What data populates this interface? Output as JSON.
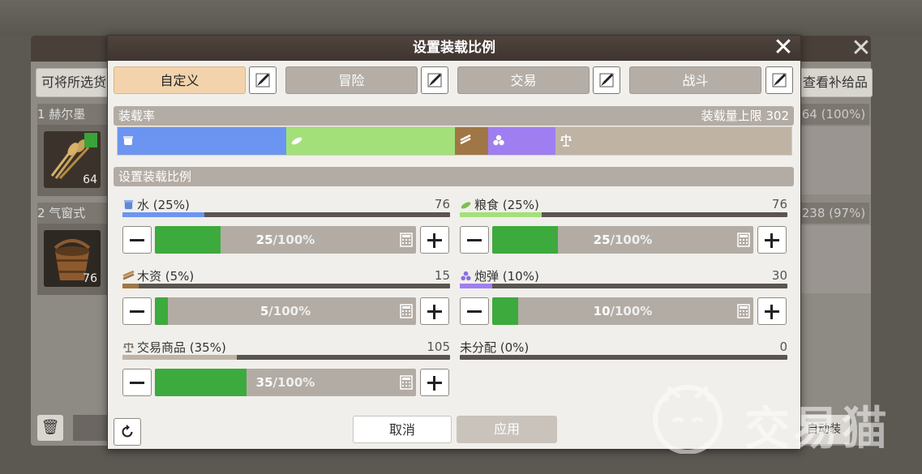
{
  "background": {
    "left_button": "可将所选货",
    "right_button": "查看补给品",
    "rows": [
      {
        "label": "1  赫尔墨",
        "right_text": "64 (100%)",
        "qty": "64"
      },
      {
        "label": "2  气窗式",
        "right_text": "238 (97%)",
        "qty": "76"
      }
    ],
    "bottom_right_button": "自动装"
  },
  "dialog": {
    "title": "设置装载比例",
    "presets": [
      {
        "label": "自定义",
        "active": true
      },
      {
        "label": "冒险",
        "active": false
      },
      {
        "label": "交易",
        "active": false
      },
      {
        "label": "战斗",
        "active": false
      }
    ],
    "load_rate": {
      "header": "装载率",
      "capacity_label": "装载量上限 302",
      "segments": [
        {
          "name": "水",
          "fraction": 0.25,
          "color": "#6b95f0",
          "icon": "water-bucket-icon"
        },
        {
          "name": "粮食",
          "fraction": 0.25,
          "color": "#a3e07a",
          "icon": "food-icon"
        },
        {
          "name": "木资",
          "fraction": 0.05,
          "color": "#a07646",
          "icon": "lumber-icon"
        },
        {
          "name": "炮弹",
          "fraction": 0.1,
          "color": "#9f7ef1",
          "icon": "cannonball-icon"
        },
        {
          "name": "交易商品",
          "fraction": 0.35,
          "color": "#bfb4a4",
          "icon": "trade-goods-icon"
        }
      ]
    },
    "ratio_header": "设置装载比例",
    "resources": [
      {
        "label": "水 (25%)",
        "value": "76",
        "fraction": 0.25,
        "bar_color": "#6b95f0",
        "slider_pct": "25",
        "slider_max": "100%",
        "icon": "water-bucket-icon"
      },
      {
        "label": "粮食 (25%)",
        "value": "76",
        "fraction": 0.25,
        "bar_color": "#a3e07a",
        "slider_pct": "25",
        "slider_max": "100%",
        "icon": "food-icon"
      },
      {
        "label": "木资 (5%)",
        "value": "15",
        "fraction": 0.05,
        "bar_color": "#a07646",
        "slider_pct": "5",
        "slider_max": "100%",
        "icon": "lumber-icon"
      },
      {
        "label": "炮弹 (10%)",
        "value": "30",
        "fraction": 0.1,
        "bar_color": "#9f7ef1",
        "slider_pct": "10",
        "slider_max": "100%",
        "icon": "cannonball-icon"
      },
      {
        "label": "交易商品 (35%)",
        "value": "105",
        "fraction": 0.35,
        "bar_color": "#bfb4a4",
        "slider_pct": "35",
        "slider_max": "100%",
        "icon": "trade-goods-icon"
      }
    ],
    "unallocated": {
      "label": "未分配 (0%)",
      "value": "0",
      "fraction": 0
    },
    "cancel_label": "取消",
    "apply_label": "应用"
  },
  "watermark": "交易猫"
}
